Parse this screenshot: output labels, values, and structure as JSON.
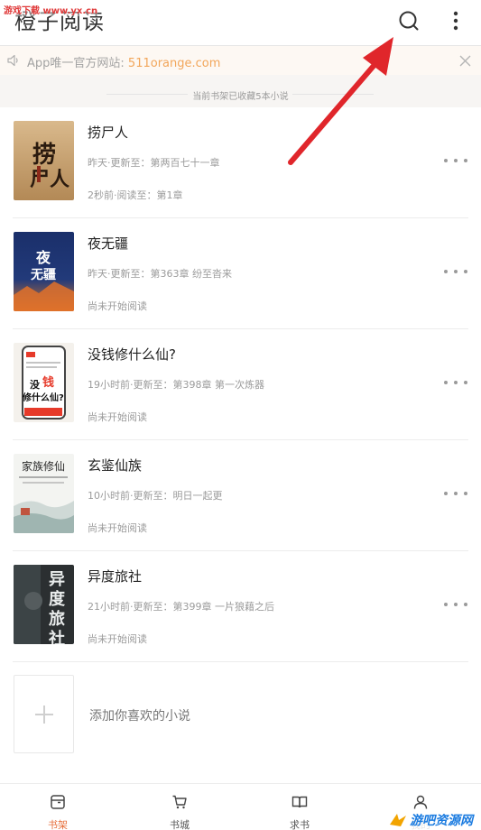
{
  "header": {
    "title": "橙子阅读",
    "watermark": "游戏下载 www.yx.cn"
  },
  "notice": {
    "text": "App唯一官方网站: ",
    "link": "511orange.com"
  },
  "shelf": {
    "count_text": "当前书架已收藏5本小说"
  },
  "books": [
    {
      "title": "捞尸人",
      "update": "昨天·更新至：第两百七十一章",
      "progress": "2秒前·阅读至：第1章",
      "cover_text": "捞尸人"
    },
    {
      "title": "夜无疆",
      "update": "昨天·更新至：第363章 纷至沓来",
      "progress": "尚未开始阅读",
      "cover_text": "夜无疆"
    },
    {
      "title": "没钱修什么仙?",
      "update": "19小时前·更新至：第398章 第一次炼器",
      "progress": "尚未开始阅读",
      "cover_text": "没钱修什么仙?"
    },
    {
      "title": "玄鉴仙族",
      "update": "10小时前·更新至：明日一起更",
      "progress": "尚未开始阅读",
      "cover_text": "家族修仙"
    },
    {
      "title": "异度旅社",
      "update": "21小时前·更新至：第399章 一片狼藉之后",
      "progress": "尚未开始阅读",
      "cover_text": "异度旅社"
    }
  ],
  "add_book": {
    "label": "添加你喜欢的小说"
  },
  "nav": {
    "shelf": "书架",
    "store": "书城",
    "request": "求书",
    "mine": "我的"
  },
  "watermark_br": "游吧资源网",
  "colors": {
    "accent": "#e76f3c",
    "notice_link": "#f2a65a",
    "arrow": "#e0262b"
  },
  "icons": {
    "search": "search-icon",
    "more": "more-vertical-icon",
    "speaker": "speaker-icon",
    "close": "close-icon",
    "book_more": "more-horizontal-icon",
    "add": "plus-icon",
    "shelf": "bookshelf-icon",
    "store": "cart-icon",
    "request": "open-book-icon",
    "mine": "person-icon"
  }
}
